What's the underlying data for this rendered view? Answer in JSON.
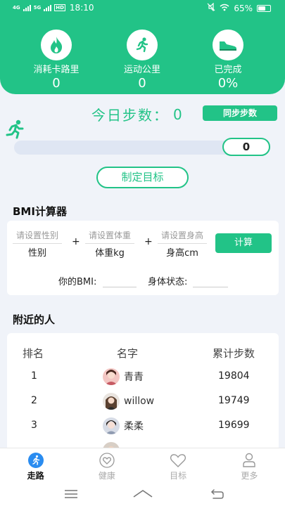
{
  "status_bar": {
    "network_1": "4G",
    "network_2": "5G",
    "hd": "HD",
    "time": "18:10",
    "battery": "65%",
    "battery_level": 0.65
  },
  "header": {
    "stats": [
      {
        "label": "消耗卡路里",
        "value": "0",
        "icon": "flame-icon"
      },
      {
        "label": "运动公里",
        "value": "0",
        "icon": "runner-icon"
      },
      {
        "label": "已完成",
        "value": "0%",
        "icon": "shoe-icon"
      }
    ]
  },
  "steps": {
    "title": "今日步数：",
    "value": "0",
    "sync_label": "同步步数",
    "progress_value": "0",
    "progress_fraction": 0
  },
  "goal_button": "制定目标",
  "bmi": {
    "section_title": "BMI计算器",
    "gender_placeholder": "请设置性别",
    "gender_unit": "性别",
    "weight_placeholder": "请设置体重",
    "weight_unit": "体重kg",
    "height_placeholder": "请设置身高",
    "height_unit": "身高cm",
    "plus": "+",
    "calc_label": "计算",
    "bmi_label": "你的BMI:",
    "status_label": "身体状态:"
  },
  "nearby": {
    "section_title": "附近的人",
    "columns": [
      "排名",
      "名字",
      "累计步数"
    ],
    "rows": [
      {
        "rank": "1",
        "name": "青青",
        "steps": "19804"
      },
      {
        "rank": "2",
        "name": "willow",
        "steps": "19749"
      },
      {
        "rank": "3",
        "name": "柔柔",
        "steps": "19699"
      }
    ]
  },
  "tabbar": {
    "tabs": [
      {
        "label": "走路",
        "icon": "walk-icon",
        "active": true
      },
      {
        "label": "健康",
        "icon": "heart-icon",
        "active": false
      },
      {
        "label": "目标",
        "icon": "heart-outline-icon",
        "active": false
      },
      {
        "label": "更多",
        "icon": "user-icon",
        "active": false
      }
    ]
  },
  "colors": {
    "accent": "#22c387",
    "background": "#f0f3f9",
    "track": "#dfe6f3"
  }
}
